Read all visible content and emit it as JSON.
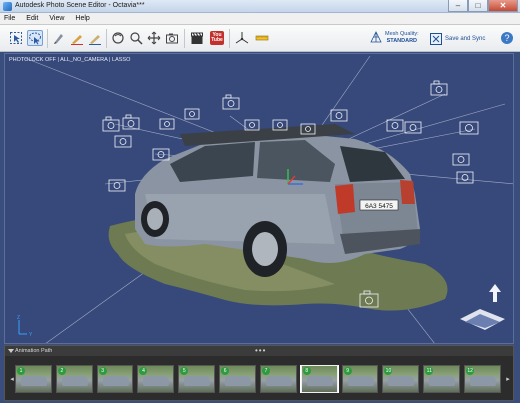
{
  "window": {
    "title": "Autodesk Photo Scene Editor - Octavia***",
    "controls": [
      "minimize",
      "maximize",
      "close"
    ]
  },
  "menu": {
    "items": [
      "File",
      "Edit",
      "View",
      "Help"
    ]
  },
  "toolbar": {
    "tools": [
      "select-icon",
      "lasso-select-icon",
      "pen-icon",
      "pencil-icon",
      "brush-icon",
      "orbit-icon",
      "pan-icon",
      "zoom-icon",
      "camera-icon",
      "clapper-icon",
      "youtube-icon",
      "axis-icon",
      "measure-icon"
    ],
    "youtube_line1": "You",
    "youtube_line2": "Tube",
    "mesh_quality_label": "Mesh Quality:",
    "mesh_quality_value": "STANDARD",
    "save_sync_label": "Save and Sync"
  },
  "viewport": {
    "status": "PHOTOLOCK OFF | ALL_NO_CAMERA | LASSO",
    "license_plate": "6A3 5475",
    "background_color": "#37497a"
  },
  "animation_path": {
    "label": "Animation Path",
    "dots": "•••",
    "thumbnails": [
      {
        "num": "1"
      },
      {
        "num": "2"
      },
      {
        "num": "3"
      },
      {
        "num": "4"
      },
      {
        "num": "5"
      },
      {
        "num": "6"
      },
      {
        "num": "7"
      },
      {
        "num": "8"
      },
      {
        "num": "9"
      },
      {
        "num": "10"
      },
      {
        "num": "11"
      },
      {
        "num": "12"
      }
    ],
    "selected_index": 7
  }
}
